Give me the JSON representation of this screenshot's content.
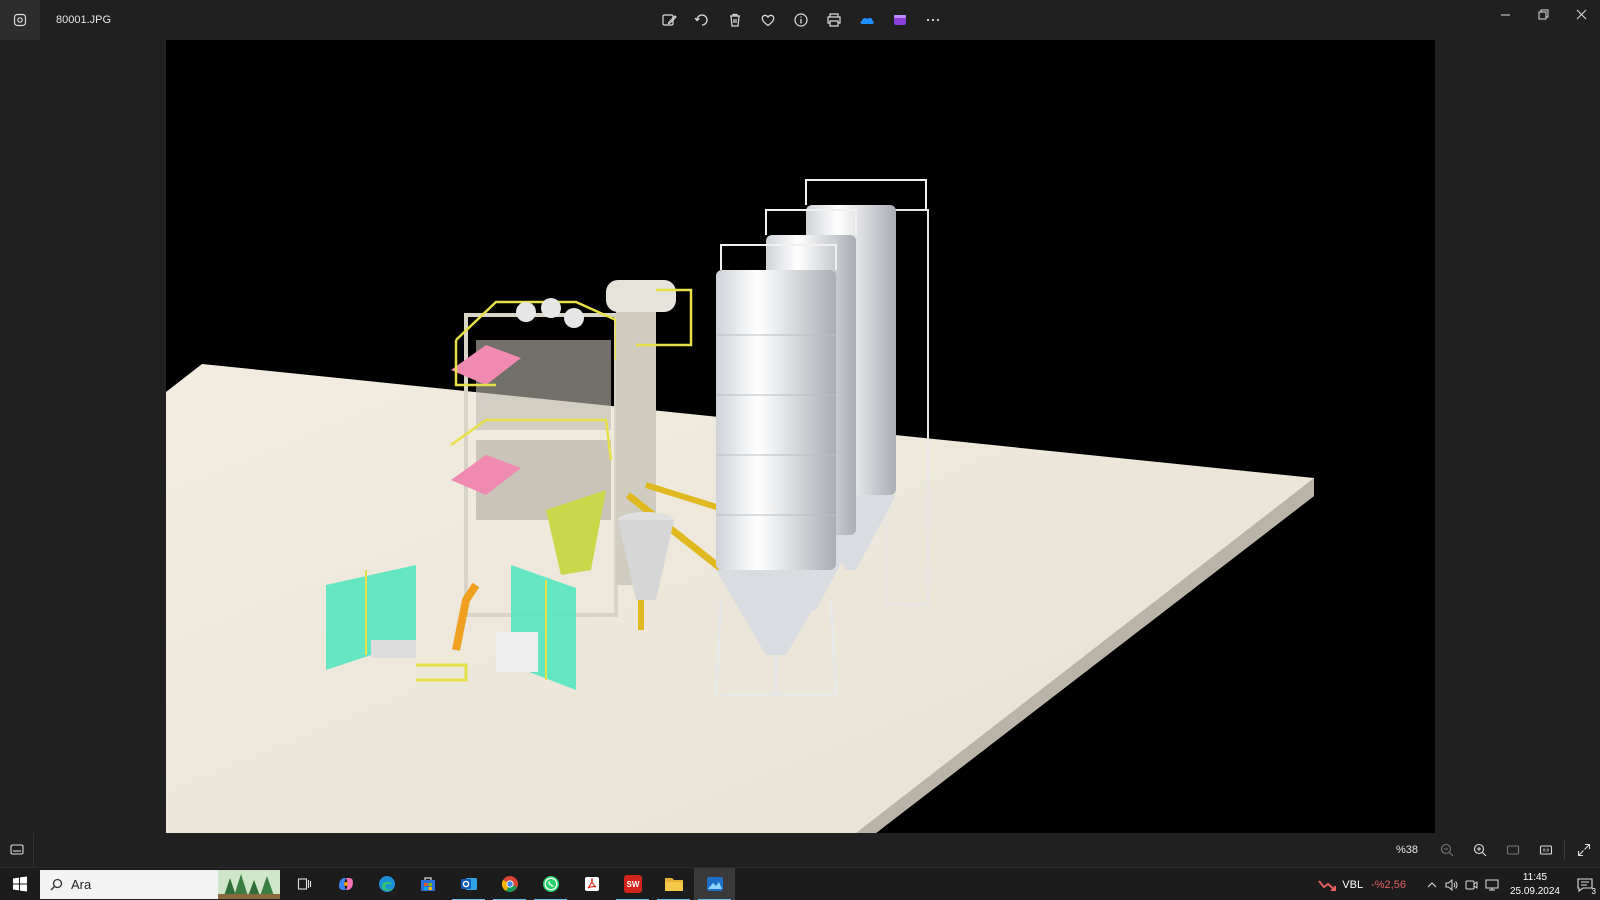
{
  "window": {
    "title": "80001.JPG",
    "app_icon": "photos-icon"
  },
  "toolbar": {
    "buttons": [
      {
        "name": "edit-image-icon"
      },
      {
        "name": "rotate-icon"
      },
      {
        "name": "delete-icon"
      },
      {
        "name": "favorite-icon"
      },
      {
        "name": "info-icon"
      },
      {
        "name": "print-icon"
      },
      {
        "name": "onedrive-icon"
      },
      {
        "name": "clipchamp-icon"
      },
      {
        "name": "more-icon",
        "label": "···"
      }
    ]
  },
  "statusbar": {
    "zoom": "%38"
  },
  "taskbar": {
    "search_placeholder": "Ara",
    "apps": [
      "task-view",
      "copilot",
      "edge",
      "store",
      "outlook",
      "chrome",
      "whatsapp",
      "acrobat",
      "solidworks",
      "file-explorer",
      "photos"
    ],
    "solidworks_label": "SW",
    "stock": {
      "symbol": "VBL",
      "change": "-%2,56"
    },
    "clock": {
      "time": "11:45",
      "date": "25.09.2024"
    },
    "notifications": "3"
  },
  "colors": {
    "accent": "#76b9ed",
    "stock_down": "#e06060"
  }
}
